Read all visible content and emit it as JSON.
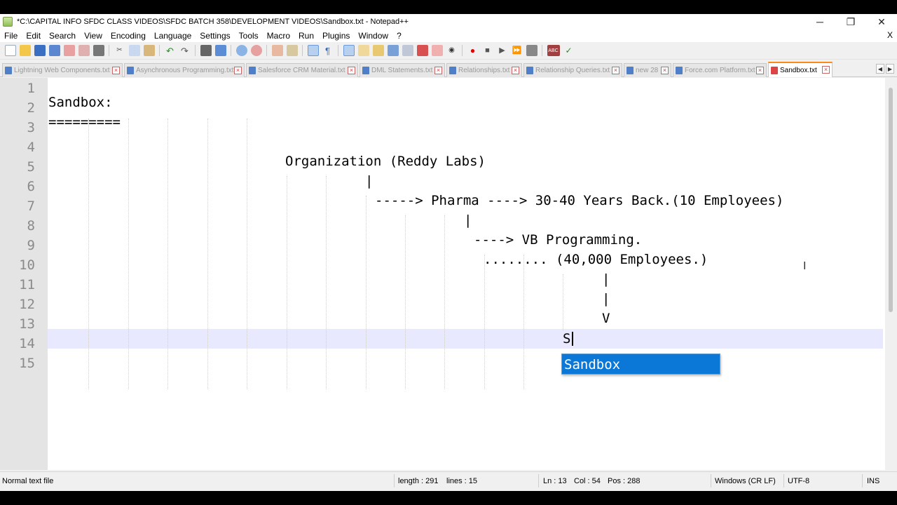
{
  "window": {
    "title": "*C:\\CAPITAL INFO SFDC CLASS VIDEOS\\SFDC BATCH 358\\DEVELOPMENT VIDEOS\\Sandbox.txt - Notepad++",
    "minimize": "─",
    "restore": "❐",
    "close": "✕"
  },
  "menu": {
    "items": [
      "File",
      "Edit",
      "Search",
      "View",
      "Encoding",
      "Language",
      "Settings",
      "Tools",
      "Macro",
      "Run",
      "Plugins",
      "Window",
      "?"
    ],
    "close_doc": "X"
  },
  "tabs": [
    {
      "label": "Lightning Web Components.txt",
      "active": false
    },
    {
      "label": "Asynchronous Programming.txt",
      "active": false
    },
    {
      "label": "Salesforce CRM Material.txt",
      "active": false
    },
    {
      "label": "DML Statements.txt",
      "active": false
    },
    {
      "label": "Relationships.txt",
      "active": false
    },
    {
      "label": "Relationship Queries.txt",
      "active": false
    },
    {
      "label": "new 28",
      "active": false
    },
    {
      "label": "Force.com Platform.txt",
      "active": false
    },
    {
      "label": "Sandbox.txt",
      "active": true
    }
  ],
  "editor": {
    "line_numbers": [
      "1",
      "2",
      "3",
      "4",
      "5",
      "6",
      "7",
      "8",
      "9",
      "10",
      "11",
      "12",
      "13",
      "14",
      "15"
    ],
    "lines": [
      "Sandbox:",
      "=========",
      "",
      "Organization (Reddy Labs)",
      "|",
      "-----> Pharma ----> 30-40 Years Back.(10 Employees)",
      "|",
      "----> VB Programming.",
      "........ (40,000 Employees.)",
      "|",
      "|",
      "V",
      "S",
      "",
      ""
    ],
    "autocomplete_suggestion": "Sandbox"
  },
  "statusbar": {
    "file_type": "Normal text file",
    "length": "length : 291",
    "lines": "lines : 15",
    "ln": "Ln : 13",
    "col": "Col : 54",
    "pos": "Pos : 288",
    "eol": "Windows (CR LF)",
    "encoding": "UTF-8",
    "mode": "INS"
  },
  "colors": {
    "active_tab_accent": "#fa8b1a",
    "current_line": "#e8e8ff",
    "autocomplete_bg": "#0b78d7"
  }
}
